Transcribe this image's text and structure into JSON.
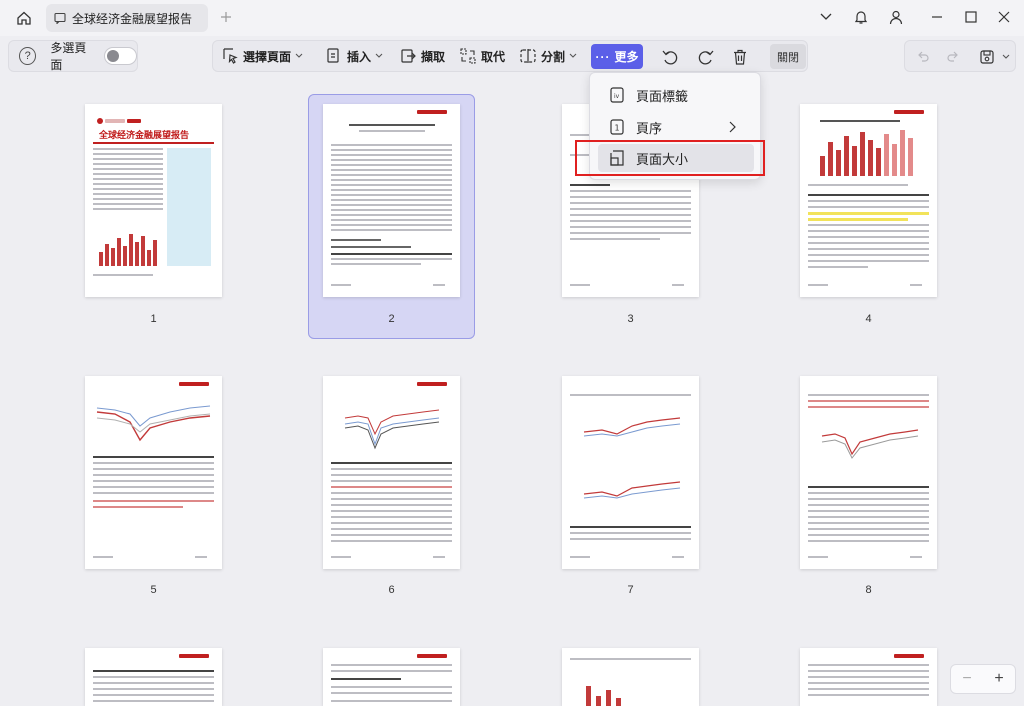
{
  "tab": {
    "title": "全球经济金融展望报告"
  },
  "toolbar": {
    "multi_select_label": "多選頁面",
    "select_page": "選擇頁面",
    "insert": "插入",
    "extract": "擷取",
    "replace": "取代",
    "split": "分割",
    "more": "更多",
    "close": "關閉"
  },
  "menu": {
    "page_label": "頁面標籤",
    "order": "頁序",
    "page_size": "頁面大小"
  },
  "pages": [
    {
      "num": "1"
    },
    {
      "num": "2"
    },
    {
      "num": "3"
    },
    {
      "num": "4"
    },
    {
      "num": "5"
    },
    {
      "num": "6"
    },
    {
      "num": "7"
    },
    {
      "num": "8"
    }
  ],
  "page1_title": "全球经济金融展望报告",
  "colors": {
    "accent": "#5b5fe8",
    "highlight_box": "#e02020",
    "selection": "#d6d6f4"
  },
  "zoom": {
    "minus": "−",
    "plus": "+"
  }
}
